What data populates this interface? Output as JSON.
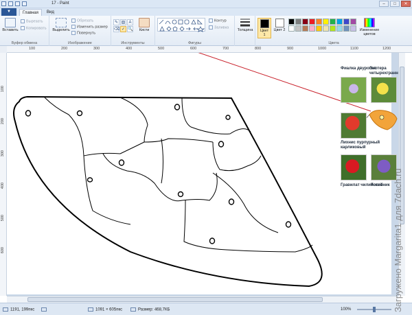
{
  "window": {
    "title": "17 - Paint",
    "controls": [
      "–",
      "□",
      "✕"
    ]
  },
  "tabs": {
    "file_label": "▼",
    "items": [
      "Главная",
      "Вид"
    ]
  },
  "ribbon": {
    "clipboard": {
      "paste": "Вставить",
      "cut": "Вырезать",
      "copy": "Копировать",
      "label": "Буфер обмена"
    },
    "image": {
      "select": "Выделить",
      "crop": "Обрезать",
      "resize": "Изменить размер",
      "rotate": "Повернуть",
      "label": "Изображение"
    },
    "tools": {
      "label": "Инструменты",
      "brushes": "Кисти",
      "items": [
        "✎",
        "▨",
        "A",
        "⌫",
        "✓",
        "🔍"
      ]
    },
    "shapes": {
      "outline": "Контур",
      "fill": "Заливка",
      "label": "Фигуры"
    },
    "size": {
      "label": "Толщина"
    },
    "colors": {
      "color1": "Цвет 1",
      "color2": "Цвет 2",
      "edit": "Изменение цветов",
      "label": "Цвета",
      "palette": [
        "#000000",
        "#7f7f7f",
        "#880015",
        "#ed1c24",
        "#ff7f27",
        "#fff200",
        "#22b14c",
        "#00a2e8",
        "#3f48cc",
        "#a349a4",
        "#ffffff",
        "#c3c3c3",
        "#b97a57",
        "#ffaec9",
        "#ffc90e",
        "#efe4b0",
        "#b5e61d",
        "#99d9ea",
        "#7092be",
        "#c8bfe7"
      ]
    }
  },
  "ruler": {
    "h_ticks": [
      "100",
      "200",
      "300",
      "400",
      "500",
      "600",
      "700",
      "800",
      "900",
      "1000",
      "1100",
      "1200"
    ],
    "v_ticks": [
      "100",
      "200",
      "300",
      "400",
      "500",
      "600"
    ]
  },
  "reference": {
    "labels": [
      "Фиалка двурогая",
      "Энотера четырехгранная",
      "Лихнис пурпурный карликовый",
      "Гравилат чилийский",
      "Котовник"
    ]
  },
  "status": {
    "cursor": "1191, 199пкс",
    "selection": "",
    "canvas_size": "1091 × 605пкс",
    "file_size": "Размер: 468,7КБ",
    "zoom": "100%"
  },
  "watermark": "Загружено Margarita1 для 7dach.ru"
}
